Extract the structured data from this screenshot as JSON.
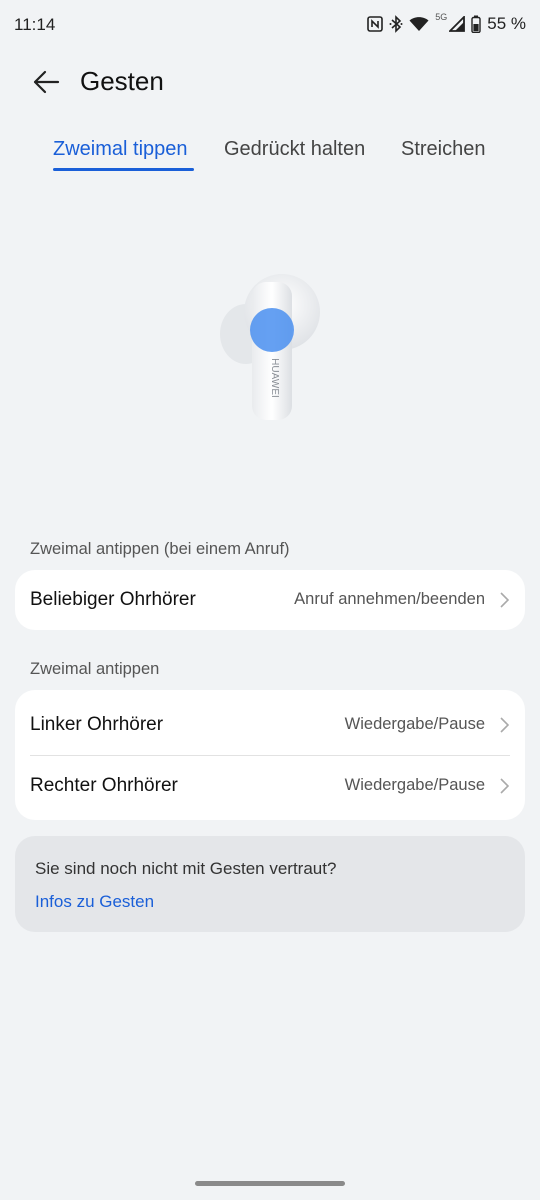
{
  "status_bar": {
    "time": "11:14",
    "network": "5G",
    "battery": "55 %",
    "icons": [
      "nfc-icon",
      "bluetooth-icon",
      "wifi-icon",
      "signal-icon",
      "battery-icon"
    ]
  },
  "header": {
    "title": "Gesten",
    "back_icon": "back-arrow-icon"
  },
  "tabs": [
    {
      "label": "Zweimal tippen",
      "active": true
    },
    {
      "label": "Gedrückt halten",
      "active": false
    },
    {
      "label": "Streichen",
      "active": false
    }
  ],
  "illustration": {
    "brand": "HUAWEI",
    "highlight_color": "#4a8ff0"
  },
  "sections": [
    {
      "label": "Zweimal antippen (bei einem Anruf)",
      "rows": [
        {
          "title": "Beliebiger Ohrhörer",
          "value": "Anruf annehmen/beenden"
        }
      ]
    },
    {
      "label": "Zweimal antippen",
      "rows": [
        {
          "title": "Linker Ohrhörer",
          "value": "Wiedergabe/Pause"
        },
        {
          "title": "Rechter Ohrhörer",
          "value": "Wiedergabe/Pause"
        }
      ]
    }
  ],
  "info": {
    "text": "Sie sind noch nicht mit Gesten vertraut?",
    "link": "Infos zu Gesten"
  },
  "colors": {
    "accent": "#1a5fd8",
    "background": "#f1f3f5",
    "card": "#ffffff"
  }
}
